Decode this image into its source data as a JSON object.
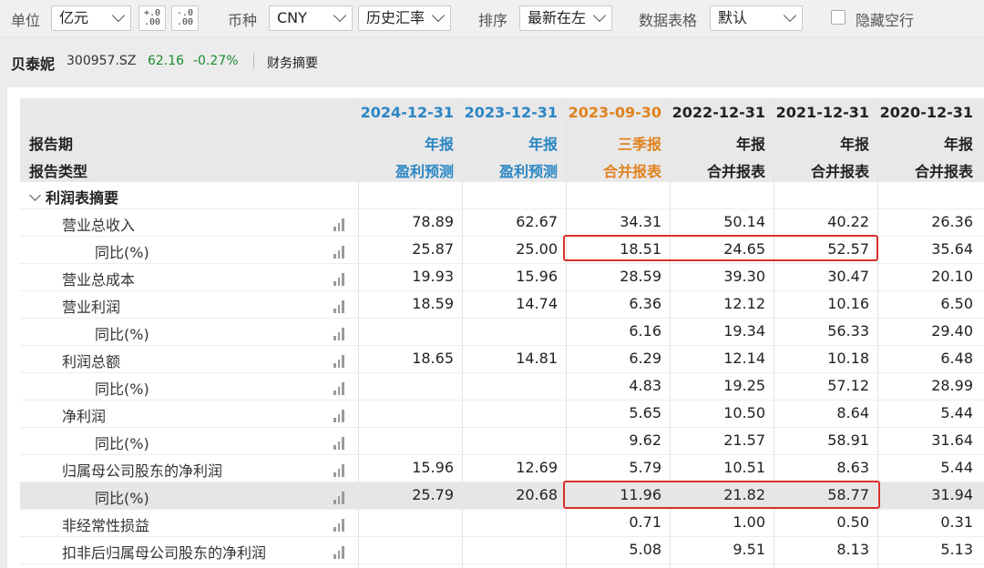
{
  "toolbar": {
    "unit_label": "单位",
    "unit_value": "亿元",
    "decimal_increase_icon": "+.0\n.00",
    "decimal_decrease_icon": "-.0\n.00",
    "currency_label": "币种",
    "currency_value": "CNY",
    "rate_value": "历史汇率",
    "sort_label": "排序",
    "sort_value": "最新在左",
    "grid_label": "数据表格",
    "grid_value": "默认",
    "hide_empty_label": "隐藏空行"
  },
  "stock": {
    "name": "贝泰妮",
    "code": "300957.SZ",
    "price": "62.16",
    "change": "-0.27%",
    "tab": "财务摘要",
    "up_down_color": "#1a8a2e"
  },
  "table": {
    "label_period": "报告期",
    "label_report_type": "报告类型",
    "columns": [
      {
        "date": "2024-12-31",
        "type": "年报",
        "kind": "盈利预测",
        "color": "blue"
      },
      {
        "date": "2023-12-31",
        "type": "年报",
        "kind": "盈利预测",
        "color": "blue"
      },
      {
        "date": "2023-09-30",
        "type": "三季报",
        "kind": "合并报表",
        "color": "orange"
      },
      {
        "date": "2022-12-31",
        "type": "年报",
        "kind": "合并报表",
        "color": "black"
      },
      {
        "date": "2021-12-31",
        "type": "年报",
        "kind": "合并报表",
        "color": "black"
      },
      {
        "date": "2020-12-31",
        "type": "年报",
        "kind": "合并报表",
        "color": "black"
      }
    ],
    "section_title": "利润表摘要",
    "rows": [
      {
        "label": "营业总收入",
        "indent": 1,
        "values": [
          "78.89",
          "62.67",
          "34.31",
          "50.14",
          "40.22",
          "26.36"
        ]
      },
      {
        "label": "同比(%)",
        "indent": 2,
        "values": [
          "25.87",
          "25.00",
          "18.51",
          "24.65",
          "52.57",
          "35.64"
        ]
      },
      {
        "label": "营业总成本",
        "indent": 1,
        "values": [
          "19.93",
          "15.96",
          "28.59",
          "39.30",
          "30.47",
          "20.10"
        ]
      },
      {
        "label": "营业利润",
        "indent": 1,
        "values": [
          "18.59",
          "14.74",
          "6.36",
          "12.12",
          "10.16",
          "6.50"
        ]
      },
      {
        "label": "同比(%)",
        "indent": 2,
        "values": [
          "",
          "",
          "6.16",
          "19.34",
          "56.33",
          "29.40"
        ]
      },
      {
        "label": "利润总额",
        "indent": 1,
        "values": [
          "18.65",
          "14.81",
          "6.29",
          "12.14",
          "10.18",
          "6.48"
        ]
      },
      {
        "label": "同比(%)",
        "indent": 2,
        "values": [
          "",
          "",
          "4.83",
          "19.25",
          "57.12",
          "28.99"
        ]
      },
      {
        "label": "净利润",
        "indent": 1,
        "values": [
          "",
          "",
          "5.65",
          "10.50",
          "8.64",
          "5.44"
        ]
      },
      {
        "label": "同比(%)",
        "indent": 2,
        "values": [
          "",
          "",
          "9.62",
          "21.57",
          "58.91",
          "31.64"
        ]
      },
      {
        "label": "归属母公司股东的净利润",
        "indent": 1,
        "values": [
          "15.96",
          "12.69",
          "5.79",
          "10.51",
          "8.63",
          "5.44"
        ]
      },
      {
        "label": "同比(%)",
        "indent": 2,
        "values": [
          "25.79",
          "20.68",
          "11.96",
          "21.82",
          "58.77",
          "31.94"
        ],
        "shaded": true
      },
      {
        "label": "非经常性损益",
        "indent": 1,
        "values": [
          "",
          "",
          "0.71",
          "1.00",
          "0.50",
          "0.31"
        ]
      },
      {
        "label": "扣非后归属母公司股东的净利润",
        "indent": 1,
        "values": [
          "",
          "",
          "5.08",
          "9.51",
          "8.13",
          "5.13"
        ]
      }
    ],
    "highlight_color": "#d9302a"
  }
}
